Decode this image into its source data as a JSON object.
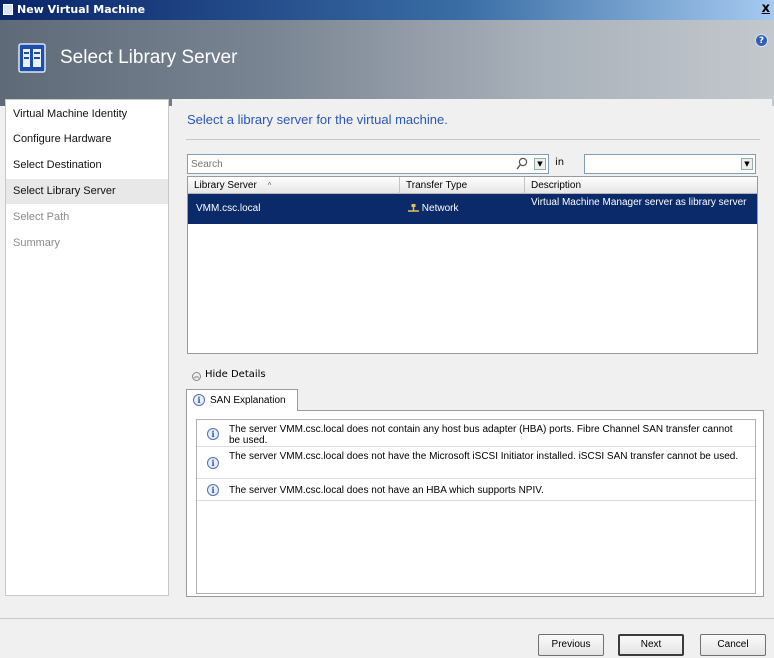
{
  "window": {
    "title": "New Virtual Machine",
    "close_glyph": "x"
  },
  "header": {
    "title": "Select Library Server",
    "help_glyph": "?"
  },
  "nav": {
    "items": [
      {
        "label": "Virtual Machine Identity",
        "state": "normal"
      },
      {
        "label": "Configure Hardware",
        "state": "normal"
      },
      {
        "label": "Select Destination",
        "state": "normal"
      },
      {
        "label": "Select Library Server",
        "state": "active"
      },
      {
        "label": "Select Path",
        "state": "disabled"
      },
      {
        "label": "Summary",
        "state": "disabled"
      }
    ]
  },
  "main": {
    "instruction": "Select a library server for the virtual machine.",
    "search": {
      "placeholder": "Search",
      "in_label": "in",
      "in_value": ""
    },
    "grid": {
      "columns": [
        "Library Server",
        "Transfer Type",
        "Description"
      ],
      "sort_indicator": "^",
      "rows": [
        {
          "server": "VMM.csc.local",
          "transfer_type": "Network",
          "description": "Virtual Machine Manager server as library server"
        }
      ]
    },
    "details_toggle": "Hide Details",
    "tab_label": "SAN Explanation",
    "messages": [
      "The server VMM.csc.local does not contain any host bus adapter (HBA) ports. Fibre Channel SAN transfer cannot be used.",
      "The server VMM.csc.local does not have the Microsoft iSCSI Initiator installed. iSCSI SAN transfer cannot be used.",
      "The server VMM.csc.local does not have an HBA which supports NPIV."
    ]
  },
  "footer": {
    "previous": "Previous",
    "next": "Next",
    "cancel": "Cancel"
  },
  "colors": {
    "selection": "#0a2a6a",
    "instruction_text": "#2a56b8",
    "title_bar": "#0a246a"
  },
  "icons": {
    "info": "info-icon",
    "network": "network-icon",
    "search": "search-icon"
  }
}
